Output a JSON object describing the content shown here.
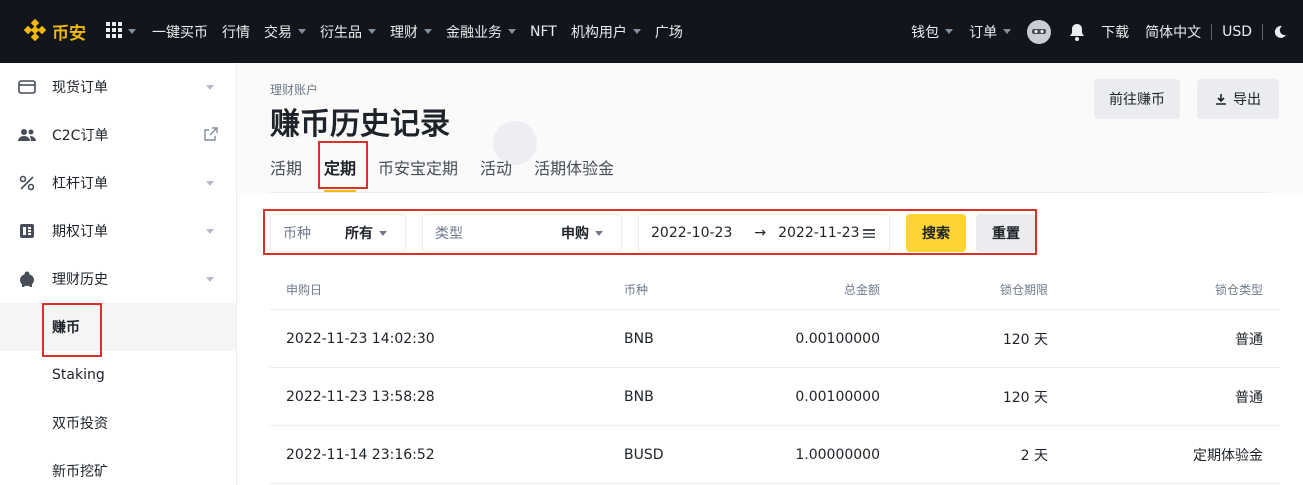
{
  "topbar": {
    "brand": "币安",
    "nav": [
      "一键买币",
      "行情",
      "交易",
      "衍生品",
      "理财",
      "金融业务",
      "NFT",
      "机构用户",
      "广场"
    ],
    "nav_carets": [
      false,
      false,
      true,
      true,
      true,
      true,
      false,
      true,
      false
    ],
    "right": {
      "wallet": "钱包",
      "orders": "订单",
      "download": "下载",
      "language": "简体中文",
      "currency": "USD"
    },
    "brand_color": "#f0b90b"
  },
  "sidebar": {
    "items": [
      {
        "label": "现货订单",
        "icon": "wallet-card-icon"
      },
      {
        "label": "C2C订单",
        "icon": "users-icon"
      },
      {
        "label": "杠杆订单",
        "icon": "percent-icon"
      },
      {
        "label": "期权订单",
        "icon": "options-icon"
      },
      {
        "label": "理财历史",
        "icon": "piggy-bank-icon"
      }
    ],
    "sub_items": [
      "赚币",
      "Staking",
      "双币投资",
      "新币挖矿"
    ]
  },
  "header": {
    "breadcrumb": "理财账户",
    "title": "赚币历史记录",
    "goto_button": "前往赚币",
    "export_button": "导出",
    "tabs": [
      "活期",
      "定期",
      "币安宝定期",
      "活动",
      "活期体验金"
    ],
    "active_tab": "定期"
  },
  "filter": {
    "coin_label": "币种",
    "coin_value": "所有",
    "type_label": "类型",
    "type_value": "申购",
    "date_from": "2022-10-23",
    "date_arrow": "→",
    "date_to": "2022-11-23",
    "search_button": "搜索",
    "reset_button": "重置"
  },
  "table": {
    "headers": [
      "申购日",
      "币种",
      "总金额",
      "锁仓期限",
      "锁仓类型"
    ],
    "rows": [
      [
        "2022-11-23 14:02:30",
        "BNB",
        "0.00100000",
        "120 天",
        "普通"
      ],
      [
        "2022-11-23 13:58:28",
        "BNB",
        "0.00100000",
        "120 天",
        "普通"
      ],
      [
        "2022-11-14 23:16:52",
        "BUSD",
        "1.00000000",
        "2 天",
        "定期体验金"
      ]
    ]
  }
}
